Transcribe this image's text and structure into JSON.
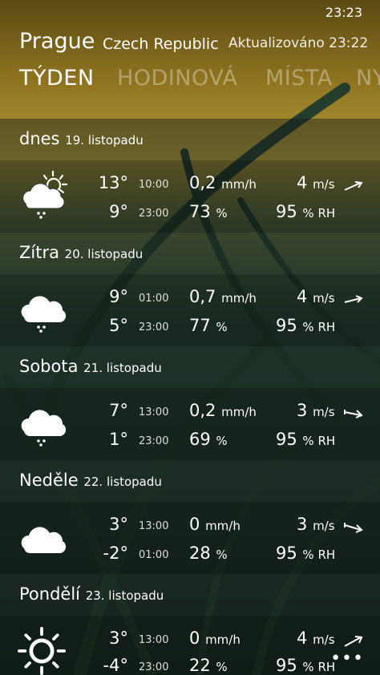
{
  "status": {
    "time": "23:23"
  },
  "header": {
    "city": "Prague",
    "country": "Czech Republic",
    "updated": "Aktualizováno 23:22"
  },
  "pivot": [
    {
      "label": "TÝDEN",
      "active": true
    },
    {
      "label": "HODINOVÁ",
      "active": false
    },
    {
      "label": "MÍSTA",
      "active": false
    },
    {
      "label": "NY",
      "active": false
    }
  ],
  "days": [
    {
      "name": "dnes",
      "date": "19. listopadu",
      "icon": "partly-sunny-rain-icon",
      "high": "13°",
      "high_time": "10:00",
      "low": "9°",
      "low_time": "23:00",
      "precip": "0,2",
      "precip_unit": "mm/h",
      "humidity": "73",
      "humidity_unit": "%",
      "wind": "4",
      "wind_unit": "m/s",
      "rh": "95",
      "rh_unit": "% RH",
      "wind_arrow": "wind-arrow-icon"
    },
    {
      "name": "Zítra",
      "date": "20. listopadu",
      "icon": "cloud-rain-icon",
      "high": "9°",
      "high_time": "01:00",
      "low": "5°",
      "low_time": "23:00",
      "precip": "0,7",
      "precip_unit": "mm/h",
      "humidity": "77",
      "humidity_unit": "%",
      "wind": "4",
      "wind_unit": "m/s",
      "rh": "95",
      "rh_unit": "% RH",
      "wind_arrow": "wind-arrow-icon"
    },
    {
      "name": "Sobota",
      "date": "21. listopadu",
      "icon": "cloud-rain-icon",
      "high": "7°",
      "high_time": "13:00",
      "low": "1°",
      "low_time": "23:00",
      "precip": "0,2",
      "precip_unit": "mm/h",
      "humidity": "69",
      "humidity_unit": "%",
      "wind": "3",
      "wind_unit": "m/s",
      "rh": "95",
      "rh_unit": "% RH",
      "wind_arrow": "wind-arrow-icon"
    },
    {
      "name": "Neděle",
      "date": "22. listopadu",
      "icon": "cloud-icon",
      "high": "3°",
      "high_time": "13:00",
      "low": "-2°",
      "low_time": "01:00",
      "precip": "0",
      "precip_unit": "mm/h",
      "humidity": "28",
      "humidity_unit": "%",
      "wind": "3",
      "wind_unit": "m/s",
      "rh": "95",
      "rh_unit": "% RH",
      "wind_arrow": "wind-arrow-icon"
    },
    {
      "name": "Pondělí",
      "date": "23. listopadu",
      "icon": "sun-icon",
      "high": "3°",
      "high_time": "13:00",
      "low": "-4°",
      "low_time": "23:00",
      "precip": "0",
      "precip_unit": "mm/h",
      "humidity": "22",
      "humidity_unit": "%",
      "wind": "4",
      "wind_unit": "m/s",
      "rh": "95",
      "rh_unit": "% RH",
      "wind_arrow": "wind-arrow-icon"
    }
  ],
  "app_bar": {
    "more_label": "•••"
  },
  "colors": {
    "sky_top": "#6e5a1a",
    "sky_mid": "#a98a25",
    "grass": "#1f3a2a"
  }
}
